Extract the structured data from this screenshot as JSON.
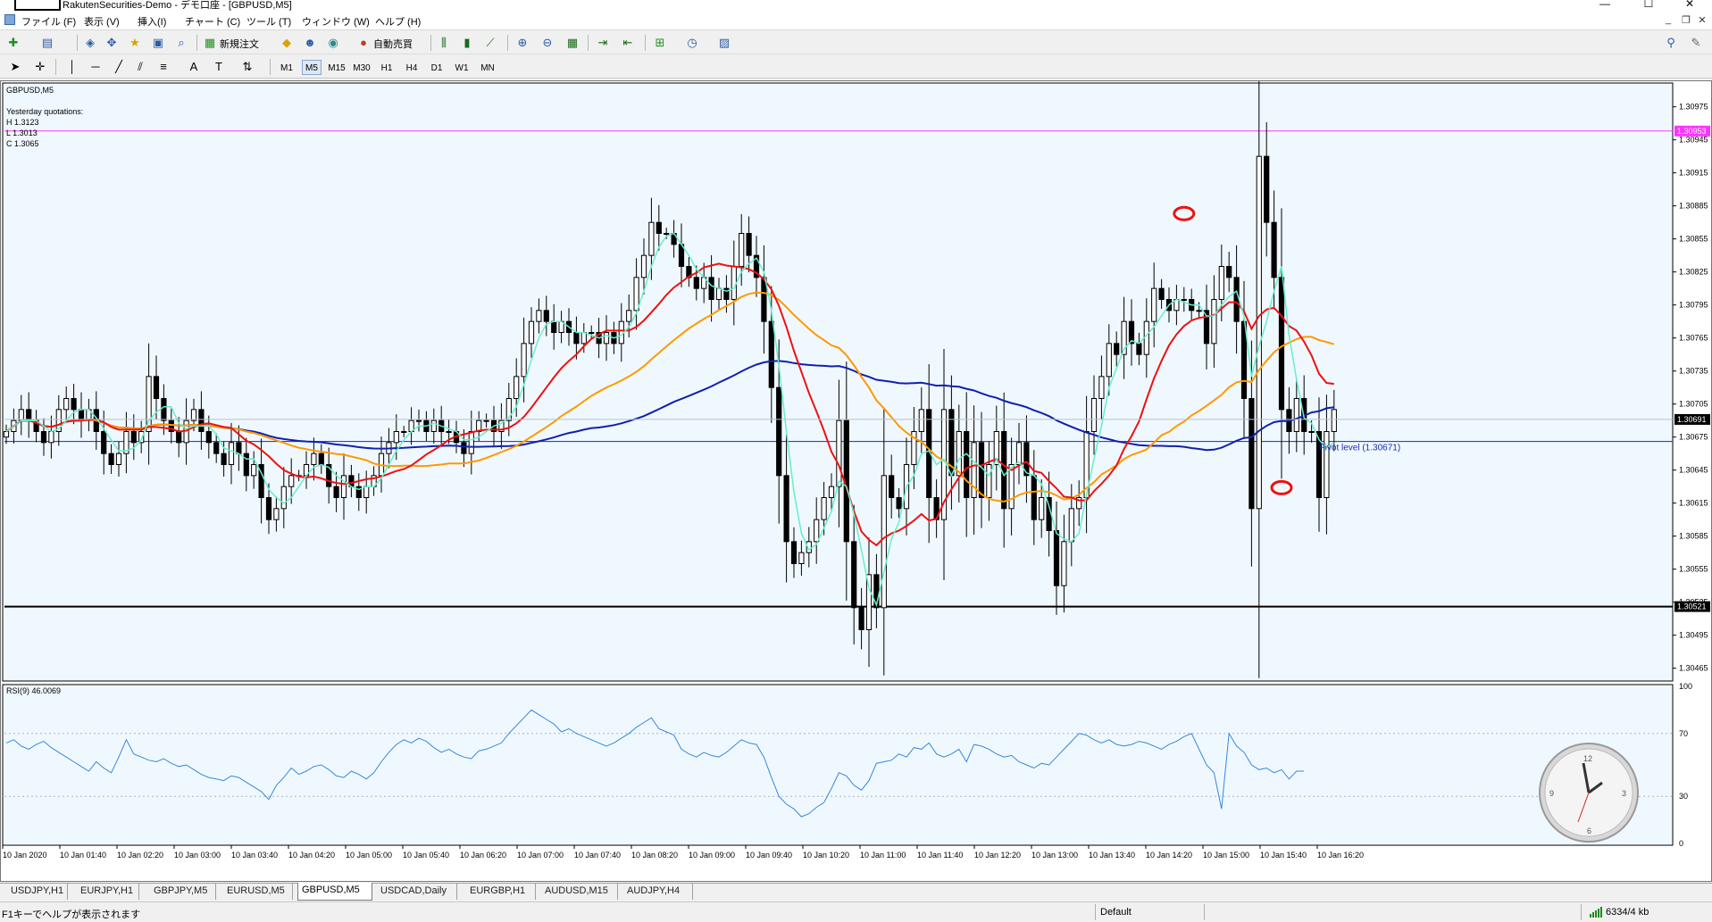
{
  "window": {
    "title": "RakutenSecurities-Demo - デモ口座 - [GBPUSD,M5]",
    "controls": [
      "—",
      "☐",
      "✕"
    ],
    "mdi_controls": [
      "_",
      "❐",
      "✕"
    ]
  },
  "menu": {
    "items": [
      "ファイル (F)",
      "表示 (V)",
      "挿入(I)",
      "チャート (C)",
      "ツール (T)",
      "ウィンドウ (W)",
      "ヘルプ (H)"
    ]
  },
  "toolbar": {
    "new_order_label": "新規注文",
    "auto_trade_label": "自動売買",
    "timeframes": [
      "M1",
      "M5",
      "M15",
      "M30",
      "H1",
      "H4",
      "D1",
      "W1",
      "MN"
    ],
    "active_timeframe": "M5"
  },
  "chart": {
    "symbol_label": "GBPUSD,M5",
    "yesterday_title": "Yesterday quotations:",
    "yesterday_h": "H 1.3123",
    "yesterday_l": "L 1.3013",
    "yesterday_c": "C 1.3065",
    "pivot_label": "Pivot level (1.30671)",
    "price_labels": {
      "magenta": "1.30953",
      "current": "1.30691",
      "support": "1.30521"
    },
    "rsi_label": "RSI(9) 46.0069",
    "colors": {
      "background": "#f0f8ff",
      "ma_fast": "#66eecc",
      "ma_mid": "#ee1111",
      "ma_slow_orange": "#ff9900",
      "ma_slow_blue": "#1020b0",
      "pivot": "#1a2ab8",
      "resistance": "#ff33ff",
      "rsi": "#3388dd",
      "annotation": "#ee1111"
    }
  },
  "chart_data": {
    "type": "candlestick",
    "symbol": "GBPUSD",
    "timeframe": "M5",
    "y_ticks": [
      "1.30975",
      "1.30945",
      "1.30915",
      "1.30885",
      "1.30855",
      "1.30825",
      "1.30795",
      "1.30765",
      "1.30735",
      "1.30705",
      "1.30675",
      "1.30645",
      "1.30615",
      "1.30585",
      "1.30555",
      "1.30525",
      "1.30495",
      "1.30465"
    ],
    "ylim": [
      1.30455,
      1.30995
    ],
    "x_ticks": [
      "10 Jan 2020",
      "10 Jan 01:40",
      "10 Jan 02:20",
      "10 Jan 03:00",
      "10 Jan 03:40",
      "10 Jan 04:20",
      "10 Jan 05:00",
      "10 Jan 05:40",
      "10 Jan 06:20",
      "10 Jan 07:00",
      "10 Jan 07:40",
      "10 Jan 08:20",
      "10 Jan 09:00",
      "10 Jan 09:40",
      "10 Jan 10:20",
      "10 Jan 11:00",
      "10 Jan 11:40",
      "10 Jan 12:20",
      "10 Jan 13:00",
      "10 Jan 13:40",
      "10 Jan 14:20",
      "10 Jan 15:00",
      "10 Jan 15:40",
      "10 Jan 16:20"
    ],
    "close": [
      1.3068,
      1.3069,
      1.307,
      1.3069,
      1.3068,
      1.3067,
      1.3068,
      1.307,
      1.3071,
      1.307,
      1.3069,
      1.307,
      1.3068,
      1.3066,
      1.3065,
      1.3066,
      1.3068,
      1.3067,
      1.3068,
      1.3073,
      1.3071,
      1.3069,
      1.3068,
      1.3067,
      1.3069,
      1.307,
      1.3068,
      1.3067,
      1.3066,
      1.3065,
      1.3067,
      1.3066,
      1.3064,
      1.3065,
      1.3062,
      1.306,
      1.3061,
      1.3063,
      1.3064,
      1.3064,
      1.3065,
      1.3066,
      1.3065,
      1.3063,
      1.3062,
      1.3064,
      1.3063,
      1.3062,
      1.3063,
      1.3064,
      1.3066,
      1.3067,
      1.3068,
      1.3068,
      1.3069,
      1.3069,
      1.3068,
      1.3069,
      1.3068,
      1.3068,
      1.3067,
      1.3066,
      1.3068,
      1.3069,
      1.3069,
      1.3068,
      1.3069,
      1.3071,
      1.3073,
      1.3076,
      1.3078,
      1.3079,
      1.3078,
      1.3077,
      1.3078,
      1.3077,
      1.3076,
      1.3077,
      1.3077,
      1.3076,
      1.3077,
      1.3076,
      1.3078,
      1.3079,
      1.3082,
      1.3084,
      1.3087,
      1.3086,
      1.3086,
      1.3085,
      1.3083,
      1.3082,
      1.3081,
      1.3082,
      1.308,
      1.3081,
      1.308,
      1.3083,
      1.3086,
      1.3084,
      1.3082,
      1.3078,
      1.3072,
      1.3064,
      1.3058,
      1.3056,
      1.3057,
      1.3058,
      1.306,
      1.3062,
      1.3063,
      1.3069,
      1.3058,
      1.3052,
      1.305,
      1.3055,
      1.3052,
      1.3064,
      1.3062,
      1.3061,
      1.3065,
      1.3068,
      1.307,
      1.3062,
      1.306,
      1.307,
      1.3064,
      1.3068,
      1.3062,
      1.3067,
      1.3062,
      1.3065,
      1.3068,
      1.3061,
      1.3065,
      1.3067,
      1.3064,
      1.306,
      1.3062,
      1.3059,
      1.3054,
      1.3058,
      1.3061,
      1.3062,
      1.3068,
      1.3071,
      1.3073,
      1.3076,
      1.3075,
      1.3078,
      1.3076,
      1.3075,
      1.3078,
      1.3081,
      1.308,
      1.3079,
      1.308,
      1.308,
      1.3079,
      1.3079,
      1.3076,
      1.308,
      1.3083,
      1.3082,
      1.3078,
      1.3071,
      1.3061,
      1.3093,
      1.3087,
      1.3082,
      1.307,
      1.3068,
      1.3071,
      1.3068,
      1.3068,
      1.3062,
      1.3068,
      1.307
    ],
    "series": [
      {
        "name": "MA fast",
        "color": "#66eecc"
      },
      {
        "name": "MA mid",
        "color": "#ee1111"
      },
      {
        "name": "MA slow",
        "color": "#ff9900"
      },
      {
        "name": "MA long",
        "color": "#1020b0"
      }
    ],
    "levels": {
      "resistance": 1.30953,
      "pivot": 1.30671,
      "support": 1.30521
    },
    "rsi": {
      "period": 9,
      "value": 46.0069,
      "ylim": [
        0,
        100
      ],
      "y_ticks": [
        "100",
        "70",
        "30",
        "0"
      ],
      "values": [
        64,
        66,
        62,
        60,
        63,
        65,
        61,
        58,
        55,
        52,
        49,
        46,
        52,
        48,
        45,
        55,
        66,
        57,
        55,
        53,
        52,
        54,
        51,
        49,
        50,
        47,
        44,
        42,
        41,
        40,
        43,
        42,
        39,
        36,
        33,
        28,
        37,
        42,
        48,
        44,
        46,
        49,
        50,
        47,
        43,
        42,
        46,
        44,
        41,
        45,
        52,
        58,
        63,
        66,
        64,
        67,
        65,
        61,
        58,
        60,
        57,
        55,
        54,
        59,
        60,
        62,
        64,
        70,
        75,
        80,
        85,
        82,
        79,
        76,
        71,
        73,
        70,
        68,
        66,
        64,
        62,
        64,
        67,
        70,
        74,
        77,
        80,
        73,
        71,
        69,
        60,
        57,
        55,
        58,
        56,
        55,
        58,
        62,
        66,
        64,
        63,
        55,
        42,
        30,
        25,
        22,
        17,
        19,
        23,
        26,
        35,
        45,
        43,
        37,
        34,
        40,
        51,
        52,
        53,
        57,
        55,
        61,
        60,
        64,
        57,
        55,
        57,
        60,
        52,
        63,
        62,
        60,
        57,
        55,
        56,
        52,
        50,
        48,
        51,
        50,
        55,
        60,
        65,
        70,
        69,
        66,
        64,
        66,
        63,
        62,
        63,
        65,
        64,
        62,
        60,
        63,
        65,
        68,
        70,
        60,
        50,
        45,
        22,
        70,
        62,
        58,
        50,
        47,
        48,
        45,
        47,
        41,
        46,
        46
      ]
    },
    "annotations": [
      {
        "shape": "ellipse",
        "index": 157,
        "price": 1.30878
      },
      {
        "shape": "ellipse",
        "index": 170,
        "price": 1.30629
      }
    ]
  },
  "tabs": {
    "items": [
      "USDJPY,H1",
      "EURJPY,H1",
      "GBPJPY,M5",
      "EURUSD,M5",
      "GBPUSD,M5",
      "USDCAD,Daily",
      "EURGBP,H1",
      "AUDUSD,M15",
      "AUDJPY,H4"
    ],
    "active": "GBPUSD,M5"
  },
  "status": {
    "help_text": "F1キーでヘルプが表示されます",
    "profile": "Default",
    "traffic": "6334/4 kb"
  }
}
